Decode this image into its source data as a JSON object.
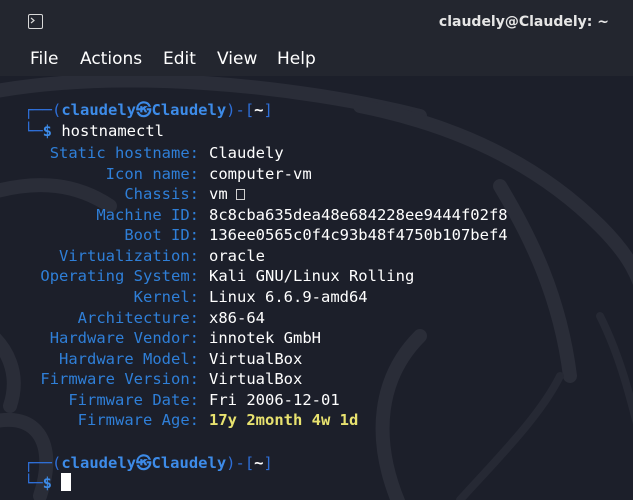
{
  "window": {
    "title": "claudely@Claudely: ~"
  },
  "menu": [
    "File",
    "Actions",
    "Edit",
    "View",
    "Help"
  ],
  "prompt": {
    "user": "claudely",
    "host": "Claudely",
    "dir": "~"
  },
  "command": "hostnamectl",
  "fields": [
    {
      "label": "Static hostname:",
      "value": "Claudely"
    },
    {
      "label": "Icon name:",
      "value": "computer-vm"
    },
    {
      "label": "Chassis:",
      "value": "vm"
    },
    {
      "label": "Machine ID:",
      "value": "8c8cba635dea48e684228ee9444f02f8"
    },
    {
      "label": "Boot ID:",
      "value": "136ee0565c0f4c93b48f4750b107bef4"
    },
    {
      "label": "Virtualization:",
      "value": "oracle"
    },
    {
      "label": "Operating System:",
      "value": "Kali GNU/Linux Rolling"
    },
    {
      "label": "Kernel:",
      "value": "Linux 6.6.9-amd64"
    },
    {
      "label": "Architecture:",
      "value": "x86-64"
    },
    {
      "label": "Hardware Vendor:",
      "value": "innotek GmbH"
    },
    {
      "label": "Hardware Model:",
      "value": "VirtualBox"
    },
    {
      "label": "Firmware Version:",
      "value": "VirtualBox"
    },
    {
      "label": "Firmware Date:",
      "value": "Fri 2006-12-01"
    },
    {
      "label": "Firmware Age:",
      "value": "17y 2month 4w 1d"
    }
  ],
  "colors": {
    "prompt_blue": "#3d8be8",
    "label_blue": "#2f7fd8",
    "warning_yellow": "#e8e26f"
  }
}
